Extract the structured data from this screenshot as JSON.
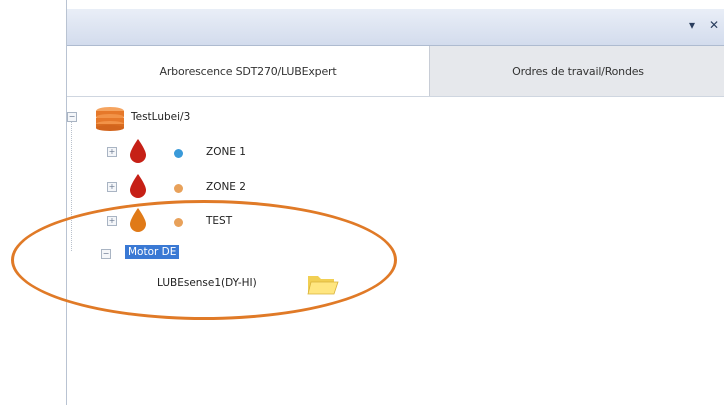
{
  "window": {
    "pin_glyph": "▾",
    "close_glyph": "✕"
  },
  "tabs": [
    {
      "label": "Arborescence SDT270/LUBExpert"
    },
    {
      "label": "Ordres de travail/Rondes"
    }
  ],
  "tree": {
    "root": {
      "label": "TestLubei/3",
      "icon": "database-icon"
    },
    "zones": [
      {
        "label": "ZONE 1",
        "status_color": "#3a9ad9"
      },
      {
        "label": "ZONE 2",
        "status_color": "#e8a15a"
      },
      {
        "label": "TEST",
        "status_color": "#e8a15a"
      }
    ],
    "machine": {
      "label": "Motor DE"
    },
    "sensor": {
      "label": "LUBEsense1(DY-HI)"
    }
  },
  "colors": {
    "drop_red": "#c62016",
    "drop_orange": "#e07a18",
    "selection": "#3a79d4",
    "annotation": "#e07a27"
  }
}
